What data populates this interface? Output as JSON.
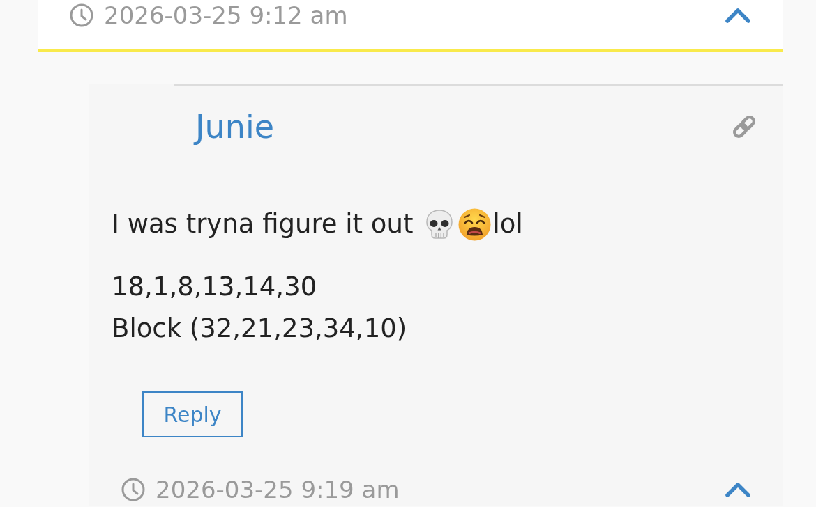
{
  "previous_comment": {
    "timestamp": "2026-03-25 9:12 am"
  },
  "comment": {
    "author": "Junie",
    "body": {
      "first_line": {
        "text": "I was tryna figure it out",
        "after_emoji": "lol"
      },
      "lines": [
        "18,1,8,13,14,30",
        "Block (32,21,23,34,10)"
      ]
    },
    "reply_button": "Reply",
    "timestamp": "2026-03-25 9:19 am"
  }
}
